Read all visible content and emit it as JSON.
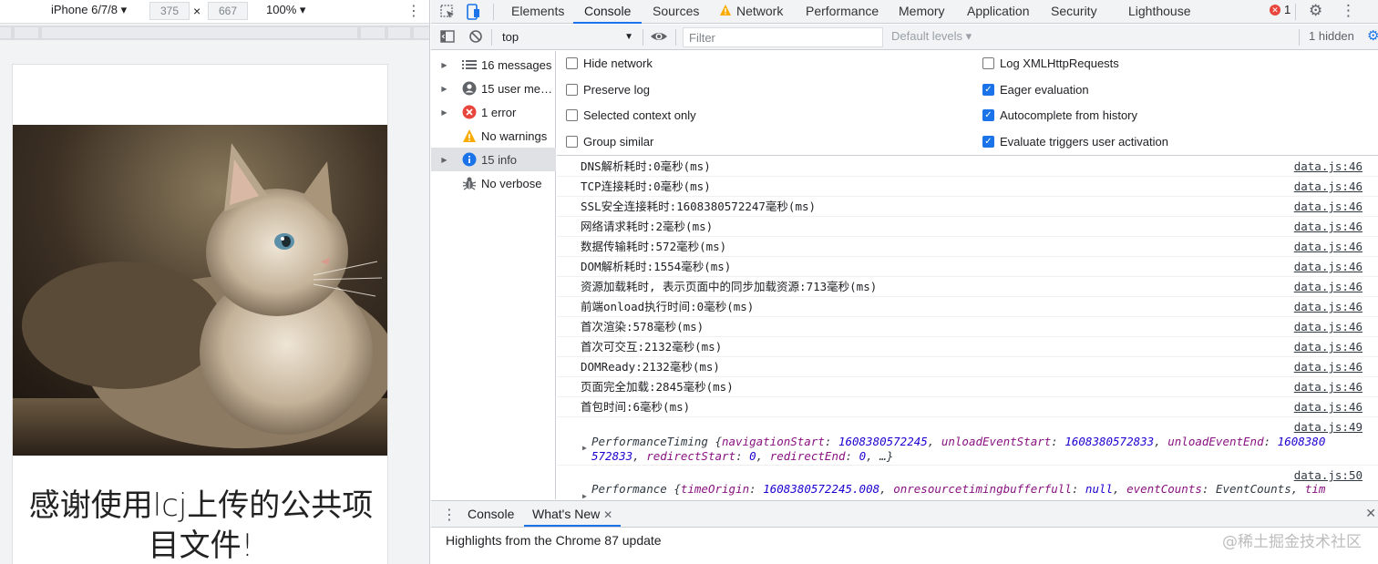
{
  "device_toolbar": {
    "device": "iPhone 6/7/8",
    "width": "375",
    "height": "667",
    "times": "×",
    "zoom": "100%"
  },
  "page": {
    "thanks_line1": "感谢使用lcj上传的公共项",
    "thanks_line2": "目文件!"
  },
  "devtools": {
    "tabs": [
      "Elements",
      "Console",
      "Sources",
      "Network",
      "Performance",
      "Memory",
      "Application",
      "Security",
      "Lighthouse"
    ],
    "active_tab": "Console",
    "error_count": "1",
    "context": "top",
    "filter_placeholder": "Filter",
    "levels": "Default levels ▾",
    "hidden": "1 hidden"
  },
  "sidebar": {
    "items": [
      {
        "label": "16 messages",
        "icon": "list-icon"
      },
      {
        "label": "15 user me…",
        "icon": "user-icon"
      },
      {
        "label": "1 error",
        "icon": "error-icon"
      },
      {
        "label": "No warnings",
        "icon": "warning-icon"
      },
      {
        "label": "15 info",
        "icon": "info-icon"
      },
      {
        "label": "No verbose",
        "icon": "bug-icon"
      }
    ]
  },
  "settings": {
    "left": [
      {
        "label": "Hide network",
        "checked": false
      },
      {
        "label": "Preserve log",
        "checked": false
      },
      {
        "label": "Selected context only",
        "checked": false
      },
      {
        "label": "Group similar",
        "checked": false
      }
    ],
    "right": [
      {
        "label": "Log XMLHttpRequests",
        "checked": false
      },
      {
        "label": "Eager evaluation",
        "checked": true
      },
      {
        "label": "Autocomplete from history",
        "checked": true
      },
      {
        "label": "Evaluate triggers user activation",
        "checked": true
      }
    ]
  },
  "logs": [
    {
      "msg": "DNS解析耗时:0毫秒(ms)",
      "src": "data.js:46"
    },
    {
      "msg": "TCP连接耗时:0毫秒(ms)",
      "src": "data.js:46"
    },
    {
      "msg": "SSL安全连接耗时:1608380572247毫秒(ms)",
      "src": "data.js:46"
    },
    {
      "msg": "网络请求耗时:2毫秒(ms)",
      "src": "data.js:46"
    },
    {
      "msg": "数据传输耗时:572毫秒(ms)",
      "src": "data.js:46"
    },
    {
      "msg": "DOM解析耗时:1554毫秒(ms)",
      "src": "data.js:46"
    },
    {
      "msg": "资源加载耗时, 表示页面中的同步加载资源:713毫秒(ms)",
      "src": "data.js:46"
    },
    {
      "msg": "前端onload执行时间:0毫秒(ms)",
      "src": "data.js:46"
    },
    {
      "msg": "首次渲染:578毫秒(ms)",
      "src": "data.js:46"
    },
    {
      "msg": "首次可交互:2132毫秒(ms)",
      "src": "data.js:46"
    },
    {
      "msg": "DOMReady:2132毫秒(ms)",
      "src": "data.js:46"
    },
    {
      "msg": "页面完全加载:2845毫秒(ms)",
      "src": "data.js:46"
    },
    {
      "msg": "首包时间:6毫秒(ms)",
      "src": "data.js:46"
    }
  ],
  "timing_obj": {
    "src": "data.js:49",
    "name": "PerformanceTiming",
    "k1": "navigationStart",
    "v1": "1608380572245",
    "k2": "unloadEventStart",
    "v2": "1608380572833",
    "k3": "unloadEventEnd",
    "v3a": "1608380",
    "v3b": "572833",
    "k4": "redirectStart",
    "v4": "0",
    "k5": "redirectEnd",
    "v5": "0",
    "ellipsis": "…}"
  },
  "perf_obj": {
    "src": "data.js:50",
    "name": "Performance",
    "k1": "timeOrigin",
    "v1": "1608380572245.008",
    "k2": "onresourcetimingbufferfull",
    "v2": "null",
    "k3": "eventCounts",
    "v3": "EventCounts",
    "k4": "tim"
  },
  "drawer": {
    "tabs": [
      "Console",
      "What's New"
    ],
    "active": "What's New",
    "content": "Highlights from the Chrome 87 update",
    "watermark": "@稀土掘金技术社区"
  }
}
